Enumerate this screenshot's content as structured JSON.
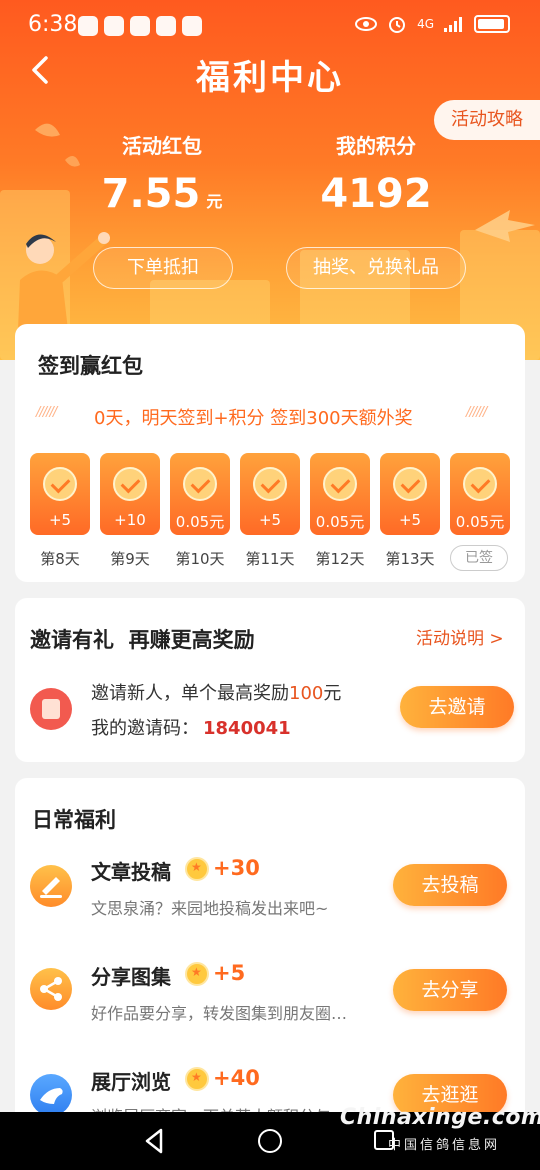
{
  "status_bar": {
    "time": "6:38",
    "network": "4G"
  },
  "header": {
    "title": "福利中心",
    "guide_label": "活动攻略"
  },
  "wallet": {
    "red_packet": {
      "label": "活动红包",
      "value": "7.55",
      "unit": "元",
      "button": "下单抵扣"
    },
    "points": {
      "label": "我的积分",
      "value": "4192",
      "button": "抽奖、兑换礼品"
    }
  },
  "checkin": {
    "title": "签到赢红包",
    "marquee": "0天，明天签到+积分 签到300天额外奖",
    "days": [
      {
        "amount": "+5",
        "label": "第8天"
      },
      {
        "amount": "+10",
        "label": "第9天"
      },
      {
        "amount": "0.05元",
        "label": "第10天"
      },
      {
        "amount": "+5",
        "label": "第11天"
      },
      {
        "amount": "0.05元",
        "label": "第12天"
      },
      {
        "amount": "+5",
        "label": "第13天"
      },
      {
        "amount": "0.05元",
        "label": "已签"
      }
    ]
  },
  "invite": {
    "title": "邀请有礼  再赚更高奖励",
    "link": "活动说明 >",
    "line1_prefix": "邀请新人，单个最高奖励",
    "line1_amount": "100",
    "line1_suffix": "元",
    "code_label": "我的邀请码：",
    "code": "1840041",
    "button": "去邀请"
  },
  "daily": {
    "title": "日常福利",
    "tasks": [
      {
        "name": "文章投稿",
        "points": "+30",
        "desc": "文思泉涌？来园地投稿发出来吧~",
        "button": "去投稿",
        "icon": "pen-icon"
      },
      {
        "name": "分享图集",
        "points": "+5",
        "desc": "好作品要分享，转发图集到朋友圈…",
        "button": "去分享",
        "icon": "share-icon"
      },
      {
        "name": "展厅浏览",
        "points": "+40",
        "desc": "浏览展厅商家，下单获大额积分与…",
        "button": "去逛逛",
        "icon": "pigeon-icon"
      }
    ]
  },
  "watermark": {
    "site": "Chinaxinge.com",
    "cn": "中国信鸽信息网"
  },
  "colors": {
    "accent": "#ff6a1f",
    "header_top": "#ff5a1f",
    "header_bottom": "#ffbe45"
  }
}
